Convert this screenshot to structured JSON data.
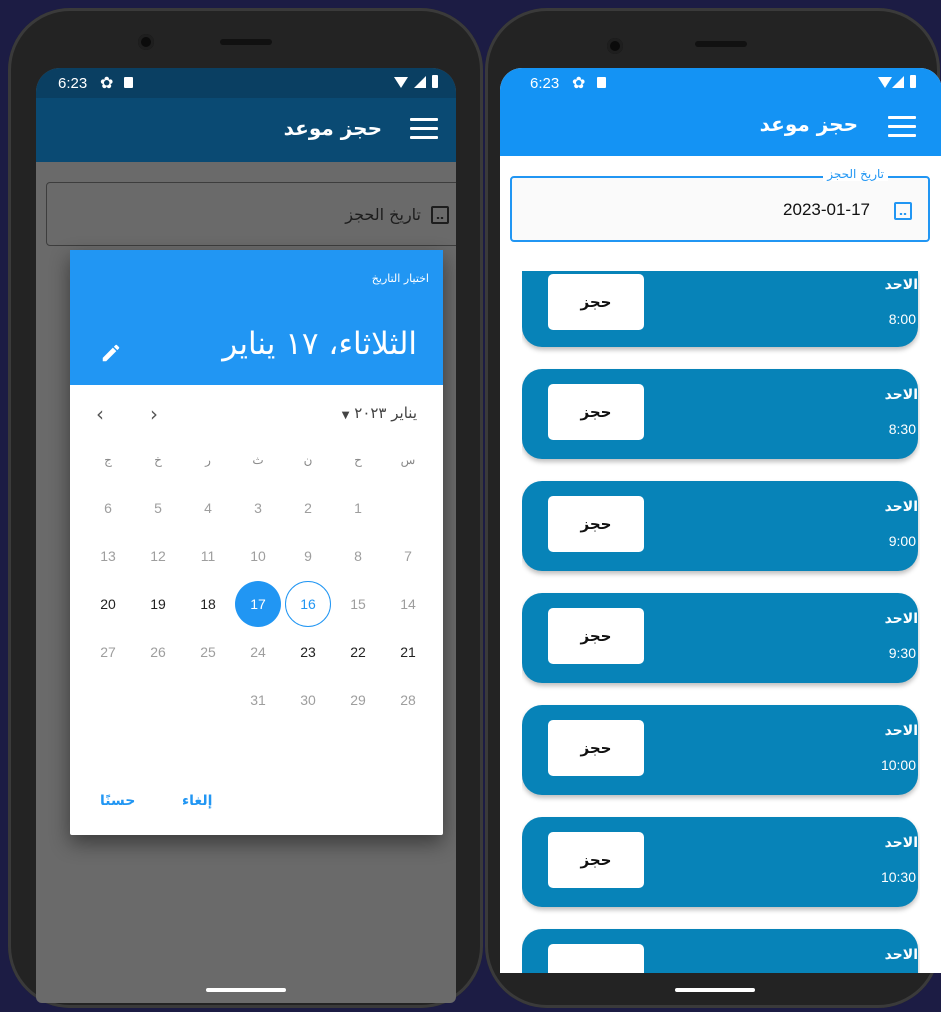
{
  "left": {
    "status": {
      "time": "6:23"
    },
    "appbar": {
      "title": "حجز موعد"
    },
    "date_field": {
      "label": "تاريخ الحجز"
    },
    "picker": {
      "help_text": "اختيار التاريخ",
      "header_date": "الثلاثاء، ١٧ يناير",
      "month_label": "يناير ٢٠٢٣",
      "prev_label": "‹",
      "next_label": "›",
      "weekdays": [
        "س",
        "ح",
        "ن",
        "ث",
        "ر",
        "خ",
        "ج"
      ],
      "week_1": [
        "1",
        "2",
        "3",
        "4",
        "5",
        "6"
      ],
      "week_2": [
        "7",
        "8",
        "9",
        "10",
        "11",
        "12",
        "13"
      ],
      "week_3": [
        "14",
        "15",
        "16",
        "17",
        "18",
        "19",
        "20"
      ],
      "week_4": [
        "21",
        "22",
        "23",
        "24",
        "25",
        "26",
        "27"
      ],
      "week_5": [
        "28",
        "29",
        "30",
        "31"
      ],
      "cancel_label": "إلغاء",
      "ok_label": "حسنًا"
    }
  },
  "right": {
    "status": {
      "time": "6:23"
    },
    "appbar": {
      "title": "حجز موعد"
    },
    "date_field": {
      "label": "تاريخ الحجز",
      "value": "2023-01-17"
    },
    "slots": [
      {
        "day": "الاحد",
        "time": "8:00",
        "button": "حجز"
      },
      {
        "day": "الاحد",
        "time": "8:30",
        "button": "حجز"
      },
      {
        "day": "الاحد",
        "time": "9:00",
        "button": "حجز"
      },
      {
        "day": "الاحد",
        "time": "9:30",
        "button": "حجز"
      },
      {
        "day": "الاحد",
        "time": "10:00",
        "button": "حجز"
      },
      {
        "day": "الاحد",
        "time": "10:30",
        "button": "حجز"
      },
      {
        "day": "الاحد",
        "time": "",
        "button": ""
      }
    ]
  },
  "colors": {
    "primary": "#2196f3",
    "appbar": "#1493f4",
    "slot": "#0783b8"
  }
}
